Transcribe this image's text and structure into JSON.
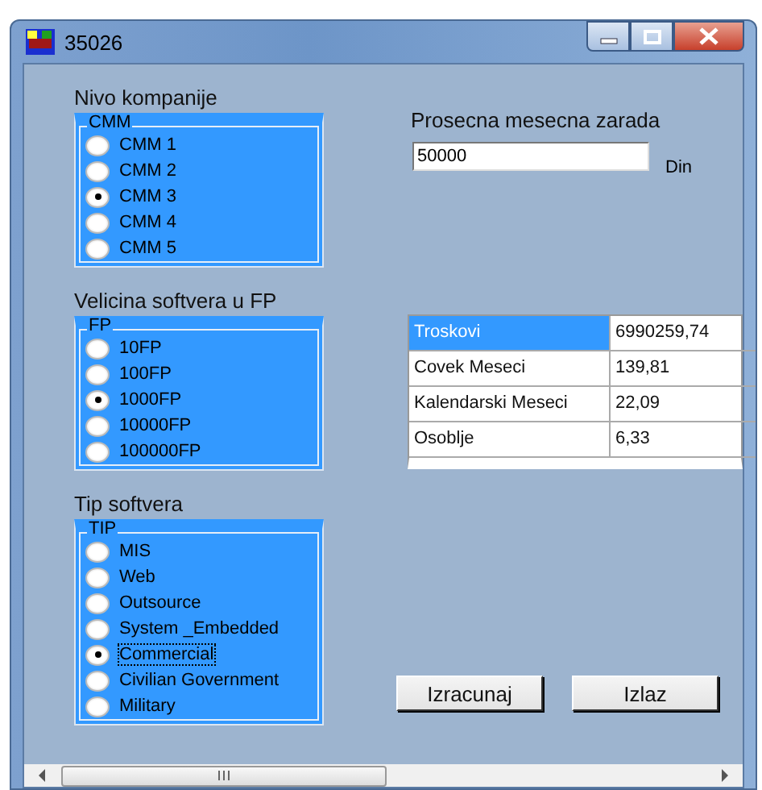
{
  "window": {
    "title": "35026"
  },
  "groups": [
    {
      "heading": "Nivo kompanije",
      "legend": "CMM",
      "options": [
        {
          "label": "CMM 1",
          "selected": false
        },
        {
          "label": "CMM 2",
          "selected": false
        },
        {
          "label": "CMM 3",
          "selected": true
        },
        {
          "label": "CMM 4",
          "selected": false
        },
        {
          "label": "CMM 5",
          "selected": false
        }
      ]
    },
    {
      "heading": "Velicina softvera u FP",
      "legend": "FP",
      "options": [
        {
          "label": "10FP",
          "selected": false
        },
        {
          "label": "100FP",
          "selected": false
        },
        {
          "label": "1000FP",
          "selected": true
        },
        {
          "label": "10000FP",
          "selected": false
        },
        {
          "label": "100000FP",
          "selected": false
        }
      ]
    },
    {
      "heading": "Tip softvera",
      "legend": "TIP",
      "options": [
        {
          "label": "MIS",
          "selected": false
        },
        {
          "label": "Web",
          "selected": false
        },
        {
          "label": "Outsource",
          "selected": false
        },
        {
          "label": "System _Embedded",
          "selected": false
        },
        {
          "label": "Commercial",
          "selected": true
        },
        {
          "label": "Civilian Government",
          "selected": false
        },
        {
          "label": "Military",
          "selected": false
        }
      ]
    }
  ],
  "salary": {
    "label": "Prosecna mesecna zarada",
    "value": "50000",
    "unit": "Din"
  },
  "results": [
    {
      "name": "Troskovi",
      "value": "6990259,74",
      "selected": true
    },
    {
      "name": "Covek Meseci",
      "value": "139,81",
      "selected": false
    },
    {
      "name": "Kalendarski Meseci",
      "value": "22,09",
      "selected": false
    },
    {
      "name": "Osoblje",
      "value": "6,33",
      "selected": false
    }
  ],
  "buttons": [
    "Izracunaj",
    "Izlaz"
  ]
}
